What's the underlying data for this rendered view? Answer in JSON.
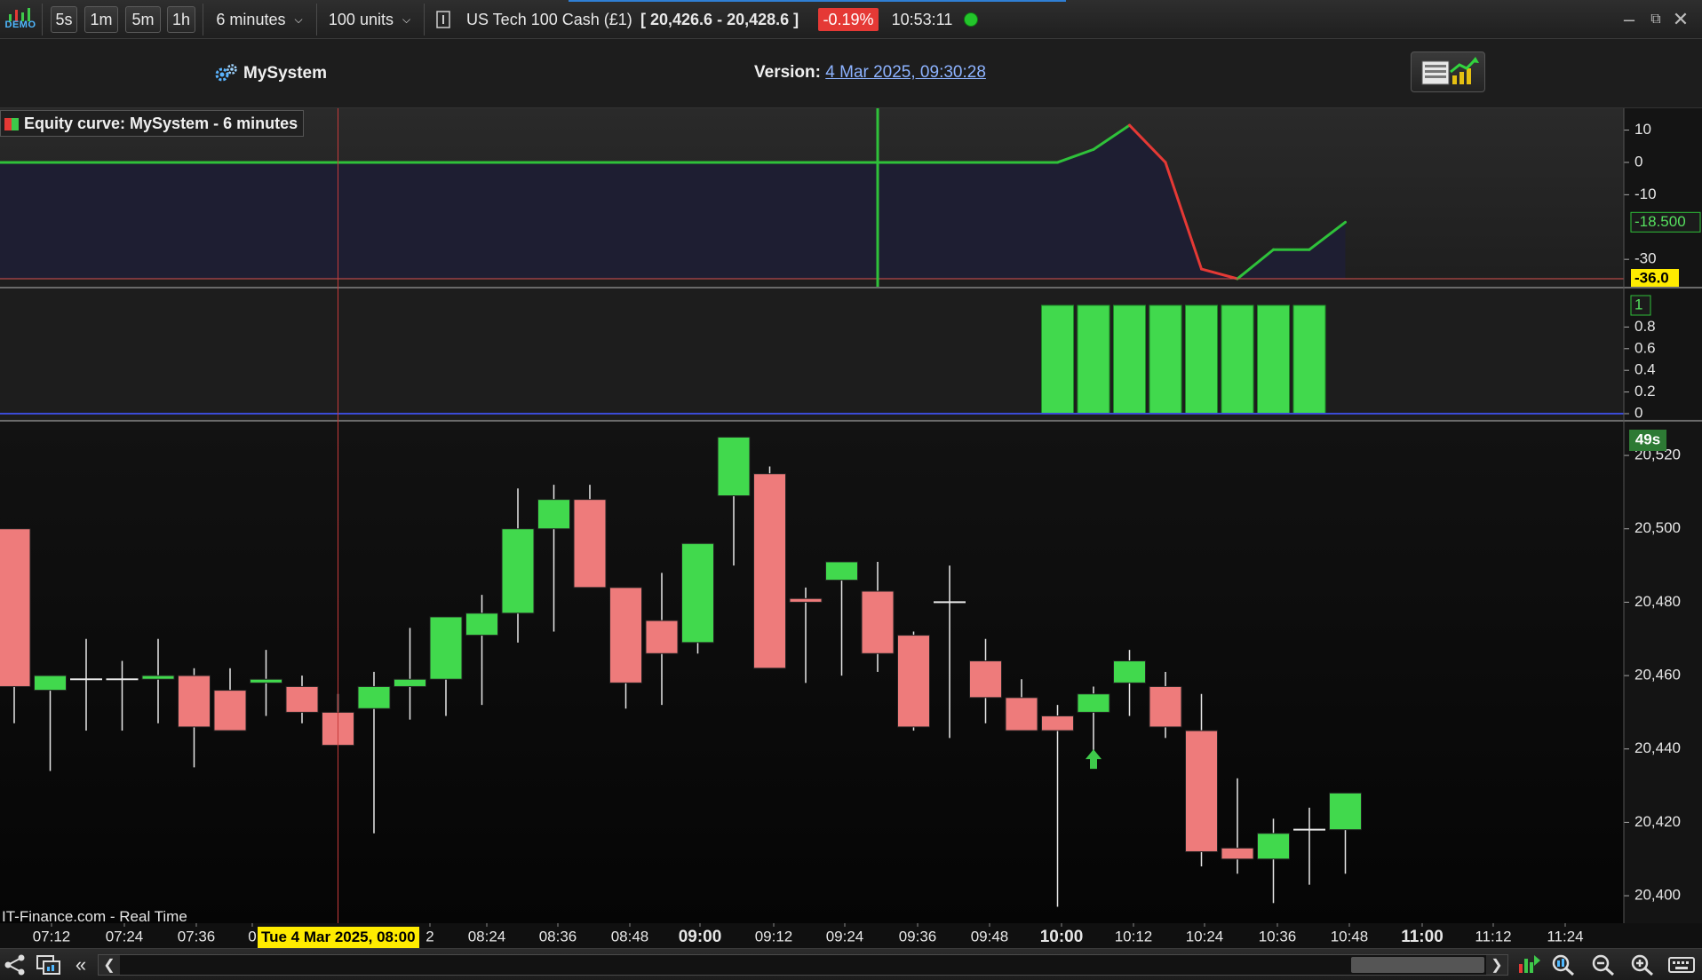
{
  "toolbar": {
    "demo_label": "DEMO",
    "periods": [
      "5s",
      "1m",
      "5m",
      "1h"
    ],
    "timeframe": "6 minutes",
    "units": "100 units",
    "instrument": "US Tech 100 Cash (£1)",
    "bid": "20,426.6",
    "ask": "20,428.6",
    "change_pct": "-0.19%",
    "time": "10:53:11"
  },
  "header": {
    "system_name": "MySystem",
    "version_label": "Version:",
    "version_value": "4 Mar 2025, 09:30:28"
  },
  "chart": {
    "legend": "Equity curve: MySystem - 6 minutes",
    "source": "IT-Finance.com - Real Time",
    "crosshair_date": "Tue 4 Mar 2025, 08:00",
    "countdown": "49s"
  },
  "chart_data": [
    {
      "type": "line",
      "panel": "equity",
      "x": [
        "07:12",
        "07:18",
        "07:24",
        "07:30",
        "07:36",
        "07:42",
        "07:48",
        "07:54",
        "08:00",
        "08:06",
        "08:12",
        "08:18",
        "08:24",
        "08:30",
        "08:36",
        "08:42",
        "08:48",
        "08:54",
        "09:00",
        "09:06",
        "09:12",
        "09:18",
        "09:24",
        "09:30",
        "09:36",
        "09:42",
        "09:48",
        "09:54",
        "10:00",
        "10:06",
        "10:12",
        "10:18",
        "10:24",
        "10:30",
        "10:36",
        "10:42",
        "10:48"
      ],
      "values": [
        0,
        0,
        0,
        0,
        0,
        0,
        0,
        0,
        0,
        0,
        0,
        0,
        0,
        0,
        0,
        0,
        0,
        0,
        0,
        0,
        0,
        0,
        0,
        0,
        0,
        0,
        0,
        0,
        0,
        4,
        11.5,
        0,
        -33,
        -36,
        -27,
        -27,
        -18.5
      ],
      "ylim": [
        -36,
        14
      ],
      "yticks": [
        "10",
        "0",
        "-10",
        "-30"
      ],
      "last_value_label": "-18.500",
      "min_value_label": "-36.0",
      "colors": {
        "up": "#2fc13a",
        "down": "#e53935",
        "fill": "#1e1e32"
      }
    },
    {
      "type": "bar",
      "panel": "position",
      "x": [
        "10:00",
        "10:06",
        "10:12",
        "10:18",
        "10:24",
        "10:30",
        "10:36",
        "10:42"
      ],
      "values": [
        1,
        1,
        1,
        1,
        1,
        1,
        1,
        1
      ],
      "ylim": [
        0,
        1
      ],
      "yticks": [
        "0.8",
        "0.6",
        "0.4",
        "0.2",
        "0"
      ],
      "last_value_label": "1",
      "colors": {
        "bar": "#41d94d",
        "zero_line": "#3b4bd6"
      }
    },
    {
      "type": "candlestick",
      "panel": "price",
      "x": [
        "07:06",
        "07:12",
        "07:18",
        "07:24",
        "07:30",
        "07:36",
        "07:42",
        "07:48",
        "07:54",
        "08:00",
        "08:06",
        "08:12",
        "08:18",
        "08:24",
        "08:30",
        "08:36",
        "08:42",
        "08:48",
        "08:54",
        "09:00",
        "09:06",
        "09:12",
        "09:18",
        "09:24",
        "09:30",
        "09:36",
        "09:42",
        "09:48",
        "09:54",
        "10:00",
        "10:06",
        "10:12",
        "10:18",
        "10:24",
        "10:30",
        "10:36",
        "10:42",
        "10:48"
      ],
      "open": [
        20500,
        20456,
        20459,
        20459,
        20459,
        20460,
        20456,
        20458,
        20457,
        20450,
        20451,
        20457,
        20459,
        20471,
        20477,
        20500,
        20508,
        20484,
        20475,
        20469,
        20509,
        20515,
        20481,
        20486,
        20483,
        20471,
        20480,
        20464,
        20454,
        20449,
        20450,
        20458,
        20457,
        20445,
        20413,
        20410,
        20418,
        20418
      ],
      "high": [
        20500,
        20460,
        20470,
        20464,
        20470,
        20462,
        20462,
        20467,
        20460,
        20455,
        20461,
        20473,
        20475,
        20482,
        20511,
        20512,
        20512,
        20484,
        20488,
        20493,
        20509,
        20517,
        20484,
        20491,
        20491,
        20472,
        20490,
        20470,
        20459,
        20452,
        20457,
        20467,
        20461,
        20455,
        20432,
        20421,
        20424,
        20427
      ],
      "low": [
        20447,
        20434,
        20445,
        20445,
        20447,
        20435,
        20446,
        20449,
        20447,
        20441,
        20417,
        20448,
        20449,
        20452,
        20469,
        20472,
        20497,
        20451,
        20452,
        20466,
        20490,
        20462,
        20458,
        20460,
        20461,
        20445,
        20443,
        20447,
        20445,
        20397,
        20438,
        20449,
        20443,
        20408,
        20406,
        20398,
        20403,
        20406
      ],
      "close": [
        20457,
        20460,
        20459,
        20459,
        20460,
        20446,
        20445,
        20459,
        20450,
        20441,
        20457,
        20459,
        20476,
        20477,
        20500,
        20508,
        20484,
        20458,
        20466,
        20496,
        20525,
        20462,
        20480,
        20491,
        20466,
        20446,
        20480,
        20454,
        20445,
        20445,
        20455,
        20464,
        20446,
        20412,
        20410,
        20417,
        20418,
        20428
      ],
      "ylim": [
        20393,
        20528
      ],
      "yticks": [
        "20,520",
        "20,500",
        "20,480",
        "20,460",
        "20,440",
        "20,420",
        "20,400"
      ],
      "colors": {
        "up": "#41d94d",
        "down": "#ee7b7b",
        "wick": "#e8e8e8"
      }
    }
  ],
  "time_axis": {
    "labels": [
      "07:12",
      "07:24",
      "07:36",
      "0",
      "2",
      "08:24",
      "08:36",
      "08:48",
      "09:00",
      "09:12",
      "09:24",
      "09:36",
      "09:48",
      "10:00",
      "10:12",
      "10:24",
      "10:36",
      "10:48",
      "11:00",
      "11:12",
      "11:24"
    ],
    "bold_labels": [
      "09:00",
      "10:00",
      "11:00"
    ]
  },
  "markers": {
    "buy_signal_time": "10:06",
    "equity_marker_time": "09:30",
    "crosshair_time": "08:00"
  }
}
